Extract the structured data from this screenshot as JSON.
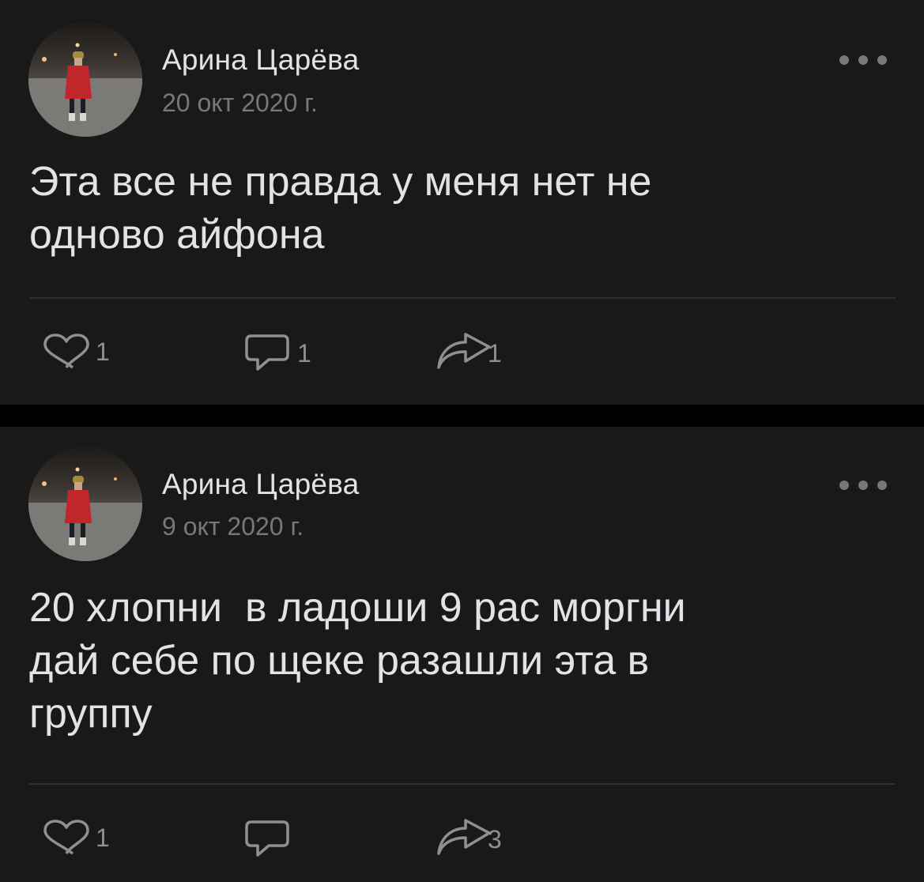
{
  "colors": {
    "background": "#000000",
    "card": "#191919",
    "text_primary": "#e1e3e6",
    "text_secondary": "#76787a",
    "divider": "#2e2f31"
  },
  "posts": [
    {
      "author": "Арина Царёва",
      "date": "20 окт 2020 г.",
      "avatar": "avatar-photo",
      "text": "Эта все не правда у меня нет не\nодново айфона",
      "menu_icon": "more-dots-icon",
      "actions": {
        "likes": {
          "icon": "heart-icon",
          "count": "1"
        },
        "comments": {
          "icon": "comment-icon",
          "count": "1"
        },
        "shares": {
          "icon": "share-icon",
          "count": "1"
        }
      }
    },
    {
      "author": "Арина Царёва",
      "date": "9 окт 2020 г.",
      "avatar": "avatar-photo",
      "text": "20 хлопни  в ладоши 9 рас моргни\nдай себе по щеке разашли эта в\nгруппу",
      "menu_icon": "more-dots-icon",
      "actions": {
        "likes": {
          "icon": "heart-icon",
          "count": "1"
        },
        "comments": {
          "icon": "comment-icon",
          "count": ""
        },
        "shares": {
          "icon": "share-icon",
          "count": "3"
        }
      }
    }
  ]
}
